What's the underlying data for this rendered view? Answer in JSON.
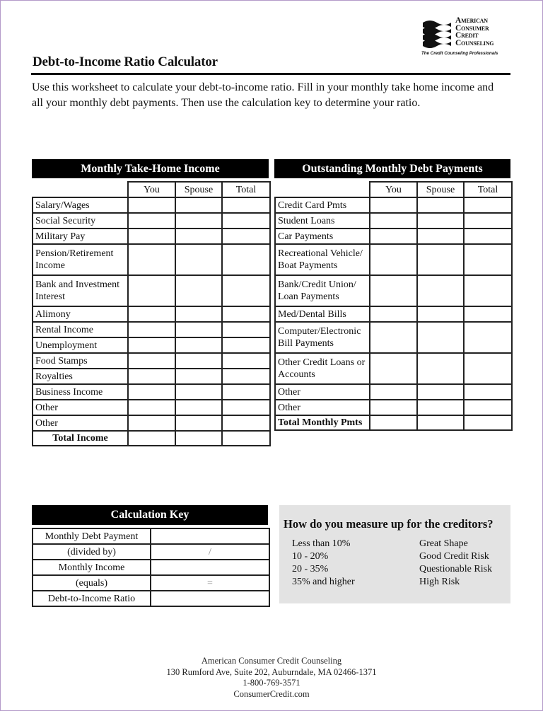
{
  "logo": {
    "lines": [
      "American",
      "Consumer",
      "Credit",
      "Counseling"
    ],
    "tagline": "The Credit Counseling Professionals",
    "icon": "wave-flag-icon"
  },
  "header": {
    "title": "Debt-to-Income Ratio Calculator",
    "intro": "Use this worksheet to calculate your debt-to-income ratio.  Fill in your monthly take home income and all your monthly debt payments.  Then use the calculation key to determine your ratio."
  },
  "income": {
    "title": "Monthly Take-Home Income",
    "columns": [
      "You",
      "Spouse",
      "Total"
    ],
    "rows": [
      "Salary/Wages",
      "Social Security",
      "Military Pay",
      "Pension/Retirement Income",
      "Bank and Investment Interest",
      "Alimony",
      "Rental Income",
      "Unemployment",
      "Food Stamps",
      "Royalties",
      "Business Income",
      "Other",
      "Other"
    ],
    "total_label": "Total Income"
  },
  "debt": {
    "title": "Outstanding Monthly Debt Payments",
    "columns": [
      "You",
      "Spouse",
      "Total"
    ],
    "rows": [
      "Credit Card Pmts",
      "Student Loans",
      "Car Payments",
      "Recreational Vehicle/ Boat Payments",
      "Bank/Credit Union/ Loan Payments",
      "Med/Dental Bills",
      "Computer/Electronic Bill Payments",
      "Other Credit Loans or Accounts",
      "Other",
      "Other"
    ],
    "total_label": "Total Monthly Pmts"
  },
  "calc_key": {
    "title": "Calculation Key",
    "rows": [
      {
        "label": "Monthly Debt Payment",
        "value": ""
      },
      {
        "label": "(divided by)",
        "value": "/"
      },
      {
        "label": "Monthly Income",
        "value": ""
      },
      {
        "label": "(equals)",
        "value": "="
      },
      {
        "label": "Debt-to-Income Ratio",
        "value": ""
      }
    ]
  },
  "measure": {
    "title": "How do you measure up for the creditors?",
    "rows": [
      {
        "range": "Less than 10%",
        "rating": "Great Shape"
      },
      {
        "range": "10 - 20%",
        "rating": "Good Credit Risk"
      },
      {
        "range": "20 - 35%",
        "rating": "Questionable Risk"
      },
      {
        "range": "35% and higher",
        "rating": "High Risk"
      }
    ]
  },
  "footer": {
    "org": "American Consumer Credit Counseling",
    "address": "130 Rumford Ave, Suite 202, Auburndale, MA 02466-1371",
    "phone": "1-800-769-3571",
    "website": "ConsumerCredit.com"
  }
}
